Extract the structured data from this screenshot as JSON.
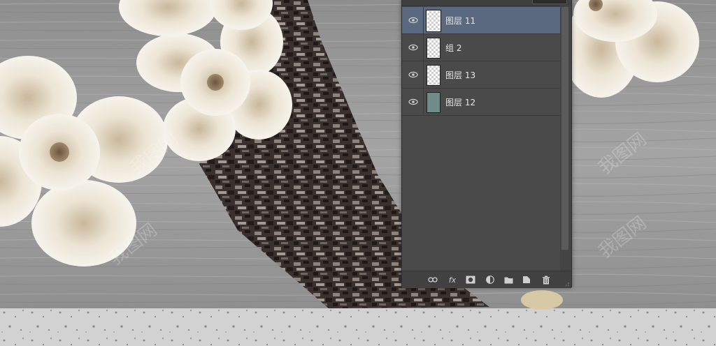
{
  "colors": {
    "panel_bg": "#4a4a4a",
    "selected_row": "#5a6880",
    "canvas_wood": "#9a9a9a",
    "bark": "#3c322f",
    "flower_petal": "#f3efe6",
    "flower_center": "#8b7358",
    "concrete": "#cfcfcf"
  },
  "layers_panel": {
    "layers": [
      {
        "name": "图层 11",
        "selected": true,
        "visible": true,
        "thumb": "transparent"
      },
      {
        "name": "组 2",
        "selected": false,
        "visible": true,
        "thumb": "transparent"
      },
      {
        "name": "图层 13",
        "selected": false,
        "visible": true,
        "thumb": "transparent"
      },
      {
        "name": "图层 12",
        "selected": false,
        "visible": true,
        "thumb": "teal"
      }
    ],
    "bottom_tools": [
      "link-icon",
      "fx-icon",
      "mask-icon",
      "adjustment-icon",
      "folder-icon",
      "new-layer-icon",
      "trash-icon"
    ],
    "fx_label": "fx"
  },
  "watermark": {
    "text": "我图网"
  }
}
